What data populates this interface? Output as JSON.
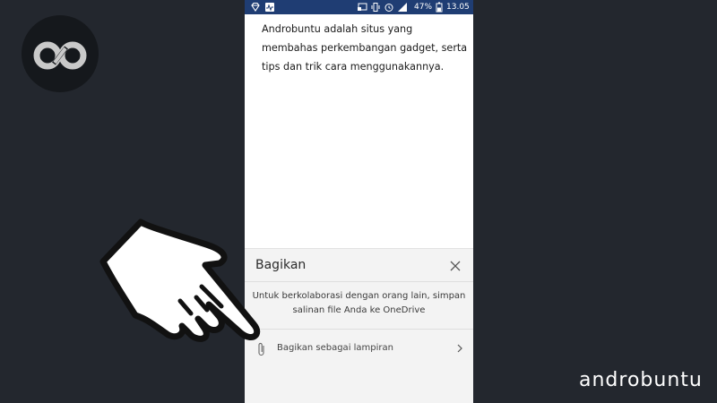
{
  "brand": {
    "logo_icon": "androbuntu-logo-icon",
    "watermark": "androbuntu"
  },
  "statusbar": {
    "battery": "47%",
    "time": "13.05",
    "icons": [
      "diamond-icon",
      "activity-icon",
      "cast-icon",
      "vibrate-icon",
      "alarm-icon",
      "signal-icon",
      "battery-icon"
    ],
    "color": "#1f3d73"
  },
  "document": {
    "lines": [
      "Androbuntu adalah situs yang",
      "membahas perkembangan gadget, serta",
      "tips dan trik cara menggunakannya."
    ]
  },
  "share_panel": {
    "title": "Bagikan",
    "description_lines": [
      "Untuk berkolaborasi dengan orang lain, simpan",
      "salinan file Anda ke OneDrive"
    ],
    "attach_option": "Bagikan sebagai lampiran"
  },
  "overlay": {
    "pointer": "pointing-hand-icon"
  }
}
